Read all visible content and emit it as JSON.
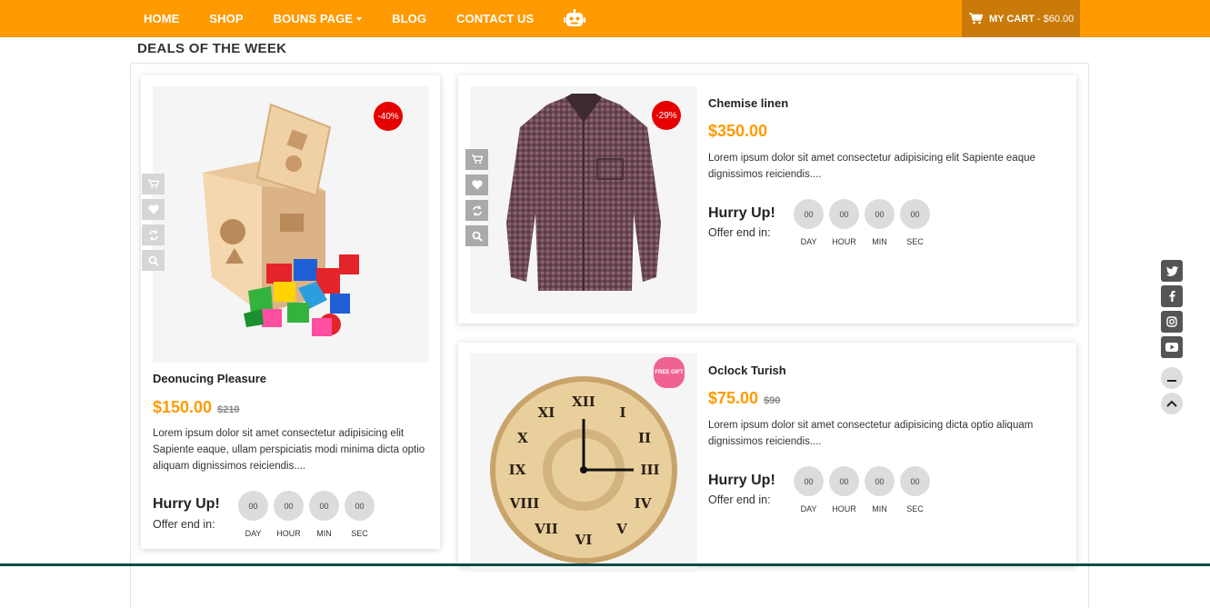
{
  "nav": {
    "items": [
      {
        "label": "HOME"
      },
      {
        "label": "SHOP"
      },
      {
        "label": "BOUNS PAGE"
      },
      {
        "label": "BLOG"
      },
      {
        "label": "CONTACT US"
      }
    ],
    "cart_label": "MY CART",
    "cart_total": "- $60.00"
  },
  "section": {
    "title": "DEALS OF THE WEEK"
  },
  "products": [
    {
      "name": "Deonucing Pleasure",
      "price": "$150.00",
      "old_price": "$210",
      "discount": "-40%",
      "description": "Lorem ipsum dolor sit amet consectetur adipisicing elit Sapiente eaque, ullam perspiciatis modi minima dicta optio aliquam dignissimos reiciendis....",
      "hurry": "Hurry Up!",
      "offer": "Offer end in:",
      "timer": [
        {
          "value": "00",
          "label": "DAY"
        },
        {
          "value": "00",
          "label": "HOUR"
        },
        {
          "value": "00",
          "label": "MIN"
        },
        {
          "value": "00",
          "label": "SEC"
        }
      ]
    },
    {
      "name": "Chemise linen",
      "price": "$350.00",
      "discount": "-29%",
      "description": "Lorem ipsum dolor sit amet consectetur adipisicing elit Sapiente eaque dignissimos reiciendis....",
      "hurry": "Hurry Up!",
      "offer": "Offer end in:",
      "timer": [
        {
          "value": "00",
          "label": "DAY"
        },
        {
          "value": "00",
          "label": "HOUR"
        },
        {
          "value": "00",
          "label": "MIN"
        },
        {
          "value": "00",
          "label": "SEC"
        }
      ]
    },
    {
      "name": "Oclock Turish",
      "price": "$75.00",
      "old_price": "$90",
      "gift": "FREE GIFT",
      "description": "Lorem ipsum dolor sit amet consectetur adipisicing dicta optio aliquam dignissimos reiciendis....",
      "hurry": "Hurry Up!",
      "offer": "Offer end in:",
      "timer": [
        {
          "value": "00",
          "label": "DAY"
        },
        {
          "value": "00",
          "label": "HOUR"
        },
        {
          "value": "00",
          "label": "MIN"
        },
        {
          "value": "00",
          "label": "SEC"
        }
      ]
    }
  ],
  "colors": {
    "accent": "#ff9a00",
    "badge": "#e60000",
    "cart_bg": "#c97a08"
  },
  "icons": [
    "robot-icon",
    "cart-icon",
    "heart-icon",
    "refresh-icon",
    "search-icon",
    "twitter-icon",
    "facebook-icon",
    "instagram-icon",
    "youtube-icon",
    "minimize-icon",
    "chevron-up-icon"
  ]
}
